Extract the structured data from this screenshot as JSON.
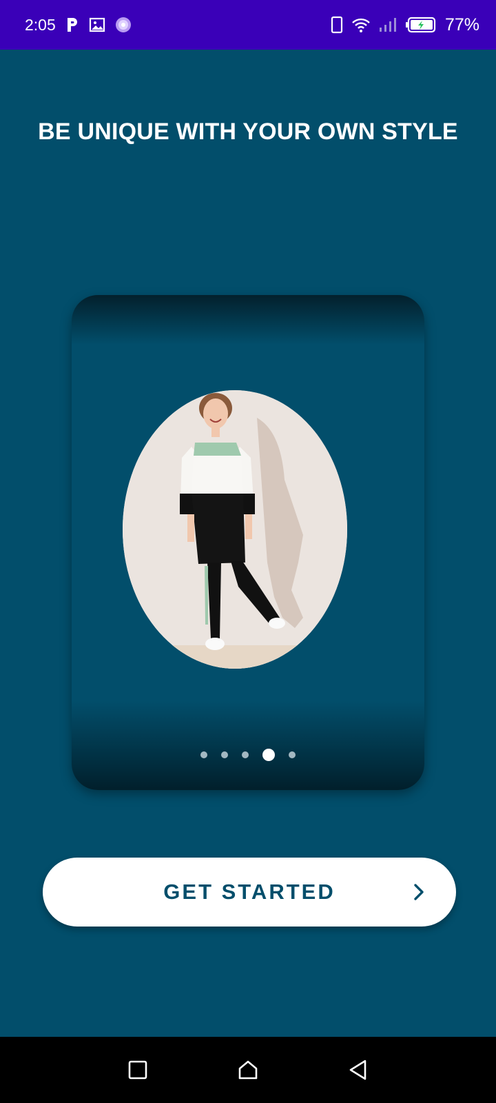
{
  "status_bar": {
    "time": "2:05",
    "battery_percent": "77%",
    "icons": [
      "parking-icon",
      "gallery-icon",
      "app-badge-icon",
      "vibrate-icon",
      "wifi-icon",
      "signal-icon",
      "battery-charging-icon"
    ]
  },
  "onboarding": {
    "headline": "BE UNIQUE WITH YOUR OWN STYLE",
    "carousel": {
      "page_count": 5,
      "active_index": 3
    },
    "cta_label": "GET STARTED"
  },
  "colors": {
    "status_bar_bg": "#3a00b8",
    "screen_bg": "#024e6b",
    "button_bg": "#ffffff",
    "button_text": "#024e6b",
    "dot_active": "#ffffff",
    "dot_inactive": "#a3b8c2"
  },
  "nav_bar": {
    "buttons": [
      "recents-icon",
      "home-icon",
      "back-icon"
    ]
  }
}
